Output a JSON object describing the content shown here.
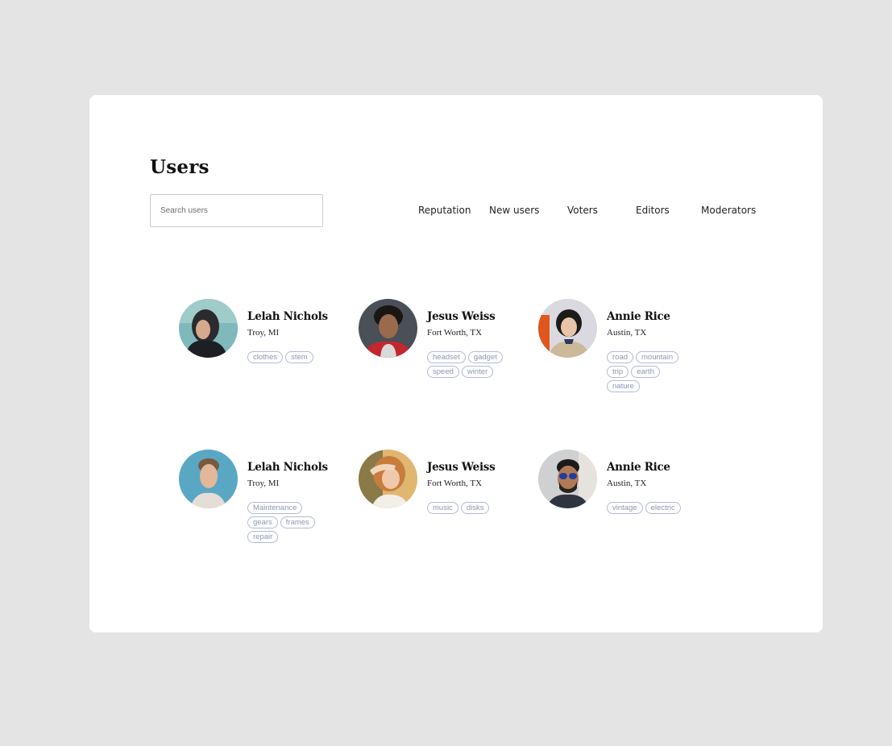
{
  "page": {
    "title": "Users"
  },
  "search": {
    "placeholder": "Search users",
    "value": ""
  },
  "filters": [
    {
      "label": "Reputation"
    },
    {
      "label": "New users"
    },
    {
      "label": "Voters"
    },
    {
      "label": "Editors"
    },
    {
      "label": "Moderators"
    }
  ],
  "users": [
    {
      "name": "Lelah Nichols",
      "location": "Troy, MI",
      "tags": [
        "clothes",
        "stem"
      ]
    },
    {
      "name": "Jesus Weiss",
      "location": "Fort Worth, TX",
      "tags": [
        "headset",
        "gadget",
        "speed",
        "winter"
      ]
    },
    {
      "name": "Annie Rice",
      "location": "Austin, TX",
      "tags": [
        "road",
        "mountain",
        "trip",
        "earth",
        "nature"
      ]
    },
    {
      "name": "Lelah Nichols",
      "location": "Troy, MI",
      "tags": [
        "Maintenance",
        "gears",
        "frames",
        "repair"
      ]
    },
    {
      "name": "Jesus Weiss",
      "location": "Fort Worth, TX",
      "tags": [
        "music",
        "disks"
      ]
    },
    {
      "name": "Annie Rice",
      "location": "Austin, TX",
      "tags": [
        "vintage",
        "electric"
      ]
    }
  ],
  "colors": {
    "background": "#e4e4e4",
    "card": "#ffffff",
    "tag_border": "#b3bad2",
    "tag_text": "#8e97b5"
  }
}
